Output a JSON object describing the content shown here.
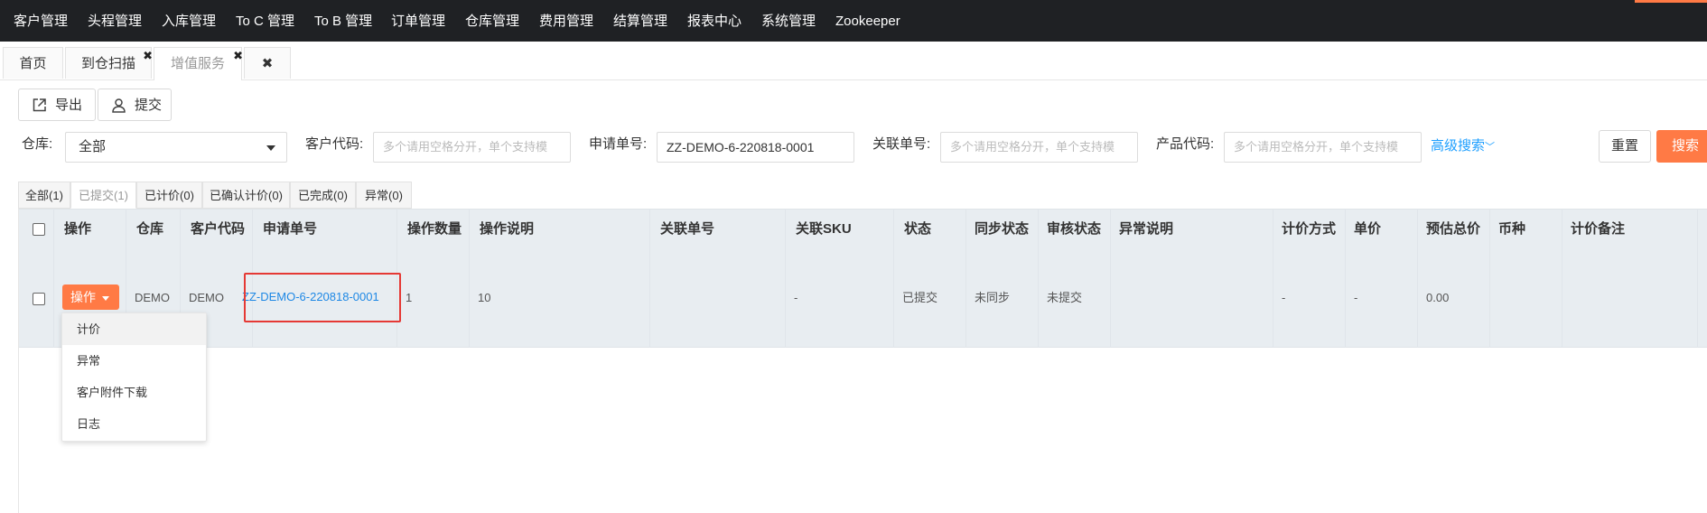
{
  "topnav": {
    "items": [
      "客户管理",
      "头程管理",
      "入库管理",
      "To C 管理",
      "To B 管理",
      "订单管理",
      "仓库管理",
      "费用管理",
      "结算管理",
      "报表中心",
      "系统管理",
      "Zookeeper"
    ]
  },
  "tabs": [
    {
      "label": "首页"
    },
    {
      "label": "到仓扫描",
      "close": "✖"
    },
    {
      "label": "增值服务",
      "close": "✖"
    },
    {
      "label": "",
      "close": "✖"
    }
  ],
  "toolbar": {
    "export_label": "导出",
    "submit_label": "提交"
  },
  "filters": {
    "warehouse_label": "仓库:",
    "warehouse_value": "全部",
    "customer_code_label": "客户代码:",
    "customer_code_placeholder": "多个请用空格分开，单个支持模",
    "request_no_label": "申请单号:",
    "request_no_value": "ZZ-DEMO-6-220818-0001",
    "related_no_label": "关联单号:",
    "related_no_placeholder": "多个请用空格分开，单个支持模",
    "product_code_label": "产品代码:",
    "product_code_placeholder": "多个请用空格分开，单个支持模",
    "advanced_label": "高级搜索",
    "reset_label": "重置",
    "search_label": "搜索"
  },
  "status_tabs": [
    "全部(1)",
    "已提交(1)",
    "已计价(0)",
    "已确认计价(0)",
    "已完成(0)",
    "异常(0)"
  ],
  "table": {
    "headers": [
      "操作",
      "仓库",
      "客户代码",
      "申请单号",
      "操作数量",
      "操作说明",
      "关联单号",
      "关联SKU",
      "状态",
      "同步状态",
      "审核状态",
      "异常说明",
      "计价方式",
      "单价",
      "预估总价",
      "币种",
      "计价备注"
    ],
    "row": {
      "op_label": "操作",
      "warehouse": "DEMO",
      "customer_code": "DEMO",
      "request_no": "ZZ-DEMO-6-220818-0001",
      "op_qty": "1",
      "op_desc": "10",
      "related_sku": "-",
      "status": "已提交",
      "sync_status": "未同步",
      "review_status": "未提交",
      "pricing_method": "-",
      "unit_price": "-",
      "est_total": "0.00"
    }
  },
  "op_menu": [
    "计价",
    "异常",
    "客户附件下载",
    "日志"
  ],
  "colors": {
    "accent": "#ff7a45",
    "link": "#1e88e5",
    "highlight": "#e53935"
  }
}
